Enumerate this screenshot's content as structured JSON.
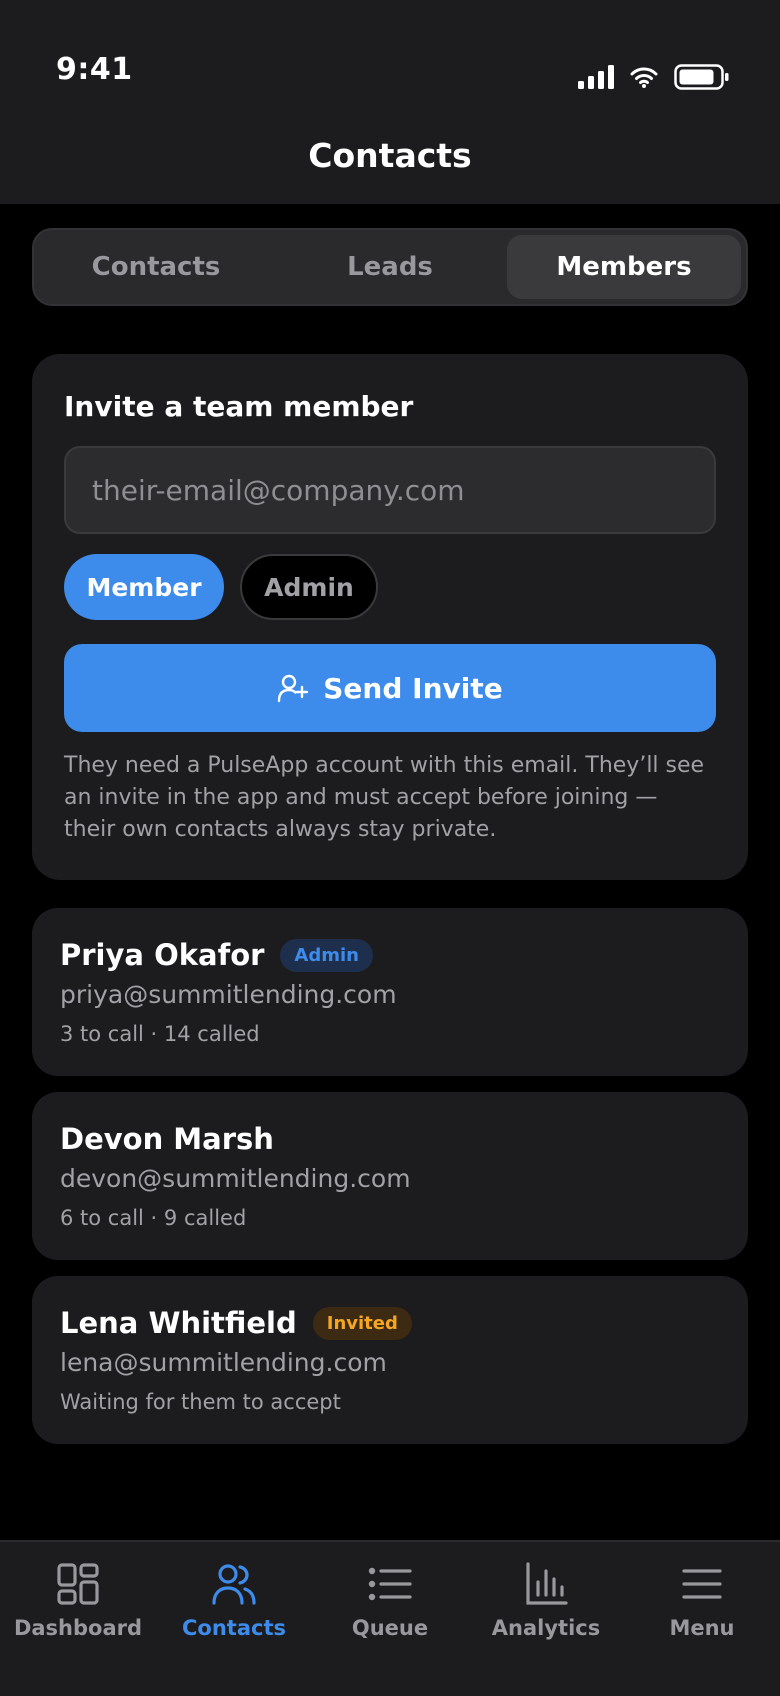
{
  "status_bar": {
    "time": "9:41"
  },
  "nav": {
    "title": "Contacts"
  },
  "segments": [
    {
      "label": "Contacts",
      "active": false
    },
    {
      "label": "Leads",
      "active": false
    },
    {
      "label": "Members",
      "active": true
    }
  ],
  "invite": {
    "title": "Invite a team member",
    "email_placeholder": "their-email@company.com",
    "email_value": "",
    "roles": [
      "Member",
      "Admin"
    ],
    "selected_role": "Member",
    "send_label": "Send Invite",
    "help_text": "They need a PulseApp account with this email. They’ll see an invite in the app and must accept before joining — their own contacts always stay private."
  },
  "members": [
    {
      "name": "Priya Okafor",
      "badge": "Admin",
      "email": "priya@summitlending.com",
      "meta": "3 to call · 14 called"
    },
    {
      "name": "Devon Marsh",
      "badge": "",
      "email": "devon@summitlending.com",
      "meta": "6 to call · 9 called"
    },
    {
      "name": "Lena Whitfield",
      "badge": "Invited",
      "email": "lena@summitlending.com",
      "meta": "Waiting for them to accept"
    }
  ],
  "tabbar": [
    {
      "label": "Dashboard",
      "icon": "dashboard-icon",
      "active": false
    },
    {
      "label": "Contacts",
      "icon": "users-icon",
      "active": true
    },
    {
      "label": "Queue",
      "icon": "list-icon",
      "active": false
    },
    {
      "label": "Analytics",
      "icon": "bar-chart-icon",
      "active": false
    },
    {
      "label": "Menu",
      "icon": "menu-icon",
      "active": false
    }
  ],
  "colors": {
    "accent": "#3d8bea",
    "background": "#000000",
    "card": "#1c1c1e",
    "invited": "#f5a623"
  }
}
